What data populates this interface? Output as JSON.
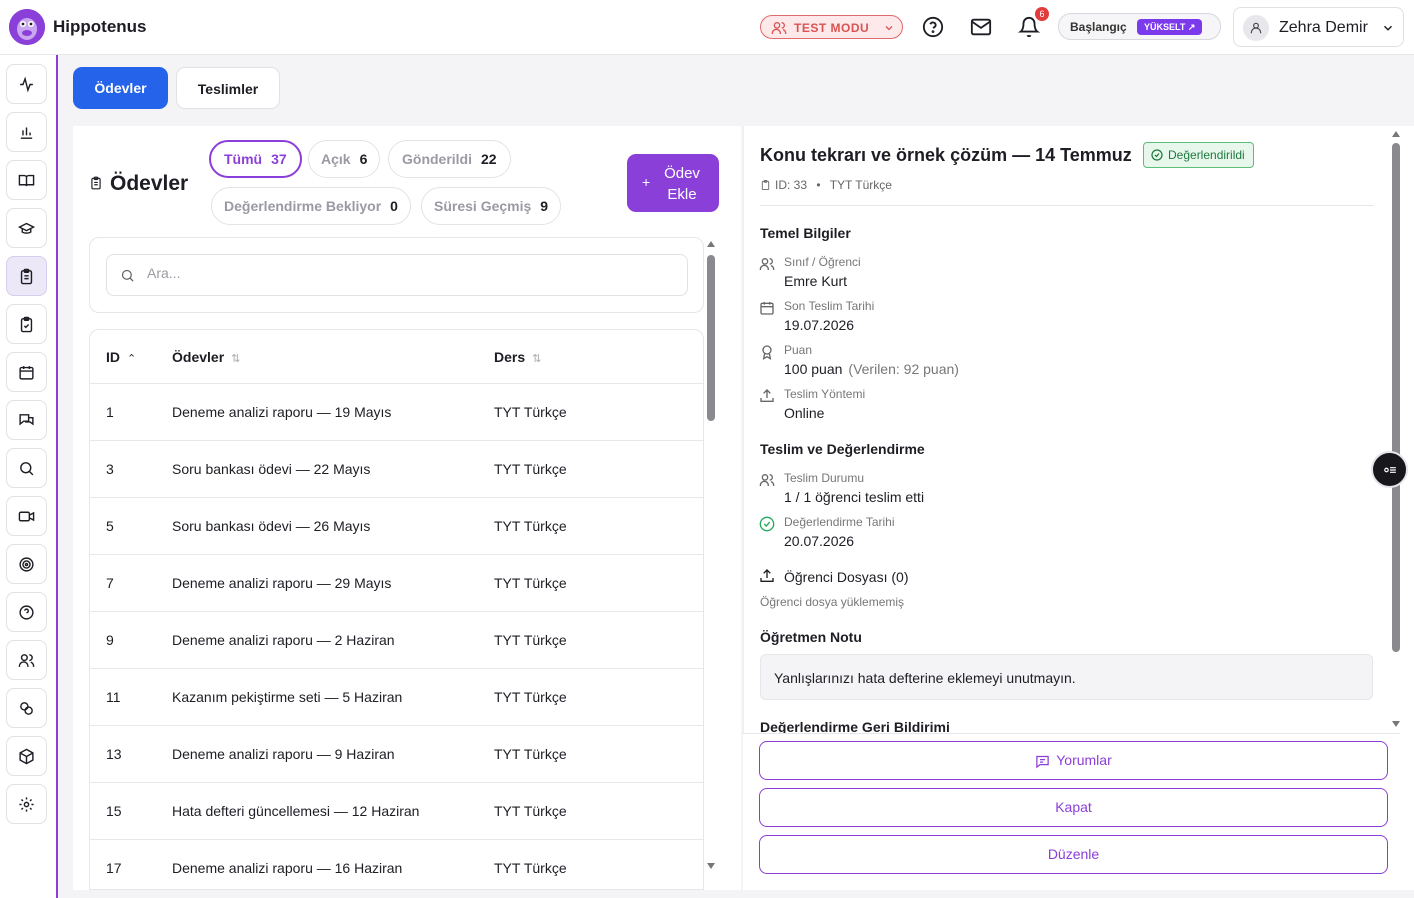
{
  "header": {
    "brand": "Hippotenus",
    "test_mode": "TEST MODU",
    "notification_count": "6",
    "plan": "Başlangıç",
    "upgrade": "YÜKSELT ↗",
    "user_name": "Zehra Demir"
  },
  "tabs": {
    "assignments": "Ödevler",
    "submissions": "Teslimler"
  },
  "list": {
    "title": "Ödevler",
    "filters": [
      {
        "label": "Tümü",
        "count": "37"
      },
      {
        "label": "Açık",
        "count": "6"
      },
      {
        "label": "Gönderildi",
        "count": "22"
      },
      {
        "label": "Değerlendirme Bekliyor",
        "count": "0"
      },
      {
        "label": "Süresi Geçmiş",
        "count": "9"
      }
    ],
    "add_button": "Ödev Ekle",
    "search_placeholder": "Ara...",
    "columns": [
      "ID",
      "Ödevler",
      "Ders"
    ],
    "rows": [
      {
        "id": "1",
        "name": "Deneme analizi raporu — 19 Mayıs",
        "course": "TYT Türkçe"
      },
      {
        "id": "3",
        "name": "Soru bankası ödevi — 22 Mayıs",
        "course": "TYT Türkçe"
      },
      {
        "id": "5",
        "name": "Soru bankası ödevi — 26 Mayıs",
        "course": "TYT Türkçe"
      },
      {
        "id": "7",
        "name": "Deneme analizi raporu — 29 Mayıs",
        "course": "TYT Türkçe"
      },
      {
        "id": "9",
        "name": "Deneme analizi raporu — 2 Haziran",
        "course": "TYT Türkçe"
      },
      {
        "id": "11",
        "name": "Kazanım pekiştirme seti — 5 Haziran",
        "course": "TYT Türkçe"
      },
      {
        "id": "13",
        "name": "Deneme analizi raporu — 9 Haziran",
        "course": "TYT Türkçe"
      },
      {
        "id": "15",
        "name": "Hata defteri güncellemesi — 12 Haziran",
        "course": "TYT Türkçe"
      },
      {
        "id": "17",
        "name": "Deneme analizi raporu — 16 Haziran",
        "course": "TYT Türkçe"
      }
    ]
  },
  "detail": {
    "title": "Konu tekrarı ve örnek çözüm — 14 Temmuz",
    "status": "Değerlendirildi",
    "id_text": "ID: 33",
    "course": "TYT Türkçe",
    "basic_info_title": "Temel Bilgiler",
    "class_label": "Sınıf / Öğrenci",
    "class_value": "Emre Kurt",
    "due_label": "Son Teslim Tarihi",
    "due_value": "19.07.2026",
    "score_label": "Puan",
    "score_value": "100 puan",
    "score_given": "(Verilen: 92 puan)",
    "method_label": "Teslim Yöntemi",
    "method_value": "Online",
    "eval_section_title": "Teslim ve Değerlendirme",
    "submission_status_label": "Teslim Durumu",
    "submission_status_value": "1 / 1 öğrenci teslim etti",
    "eval_date_label": "Değerlendirme Tarihi",
    "eval_date_value": "20.07.2026",
    "files_title": "Öğrenci Dosyası (0)",
    "files_empty": "Öğrenci dosya yüklememiş",
    "teacher_note_title": "Öğretmen Notu",
    "teacher_note": "Yanlışlarınızı hata defterine eklemeyi unutmayın.",
    "feedback_title": "Değerlendirme Geri Bildirimi",
    "buttons": {
      "comments": "Yorumlar",
      "close": "Kapat",
      "edit": "Düzenle"
    }
  },
  "colors": {
    "primary_purple": "#8b3fd9",
    "primary_blue": "#2563eb",
    "success_green": "#1f7a3f",
    "danger_red": "#d95353"
  },
  "sidebar_icons": [
    "activity-icon",
    "bar-chart-icon",
    "book-icon",
    "graduation-cap-icon",
    "clipboard-list-icon",
    "clipboard-check-icon",
    "calendar-icon",
    "messages-icon",
    "search-icon",
    "video-icon",
    "target-icon",
    "help-circle-icon",
    "users-icon",
    "badge-icon",
    "package-icon",
    "settings-icon"
  ]
}
